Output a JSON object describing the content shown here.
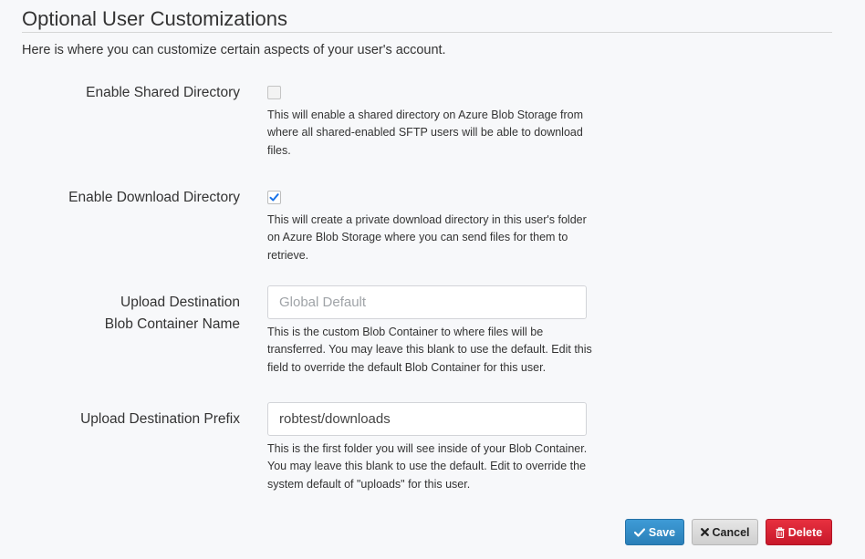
{
  "header": {
    "title": "Optional User Customizations",
    "intro": "Here is where you can customize certain aspects of your user's account."
  },
  "fields": {
    "shared_directory": {
      "label": "Enable Shared Directory",
      "checked": false,
      "help": "This will enable a shared directory on Azure Blob Storage from where all shared-enabled SFTP users will be able to download files."
    },
    "download_directory": {
      "label": "Enable Download Directory",
      "checked": true,
      "help": "This will create a private download directory in this user's folder on Azure Blob Storage where you can send files for them to retrieve."
    },
    "upload_container": {
      "label_line1": "Upload Destination",
      "label_line2": "Blob Container Name",
      "value": "",
      "placeholder": "Global Default",
      "help": "This is the custom Blob Container to where files will be transferred. You may leave this blank to use the default. Edit this field to override the default Blob Container for this user."
    },
    "upload_prefix": {
      "label": "Upload Destination Prefix",
      "value": "robtest/downloads",
      "placeholder": "",
      "help": "This is the first folder you will see inside of your Blob Container. You may leave this blank to use the default. Edit to override the system default of \"uploads\" for this user."
    }
  },
  "actions": {
    "save_label": "Save",
    "cancel_label": "Cancel",
    "delete_label": "Delete",
    "save_icon": "check-icon",
    "cancel_icon": "times-icon",
    "delete_icon": "trash-icon"
  },
  "colors": {
    "checkbox_accent": "#1a73e8",
    "save": "#2d87c6",
    "cancel": "#d9d9d9",
    "delete": "#d9202f"
  }
}
